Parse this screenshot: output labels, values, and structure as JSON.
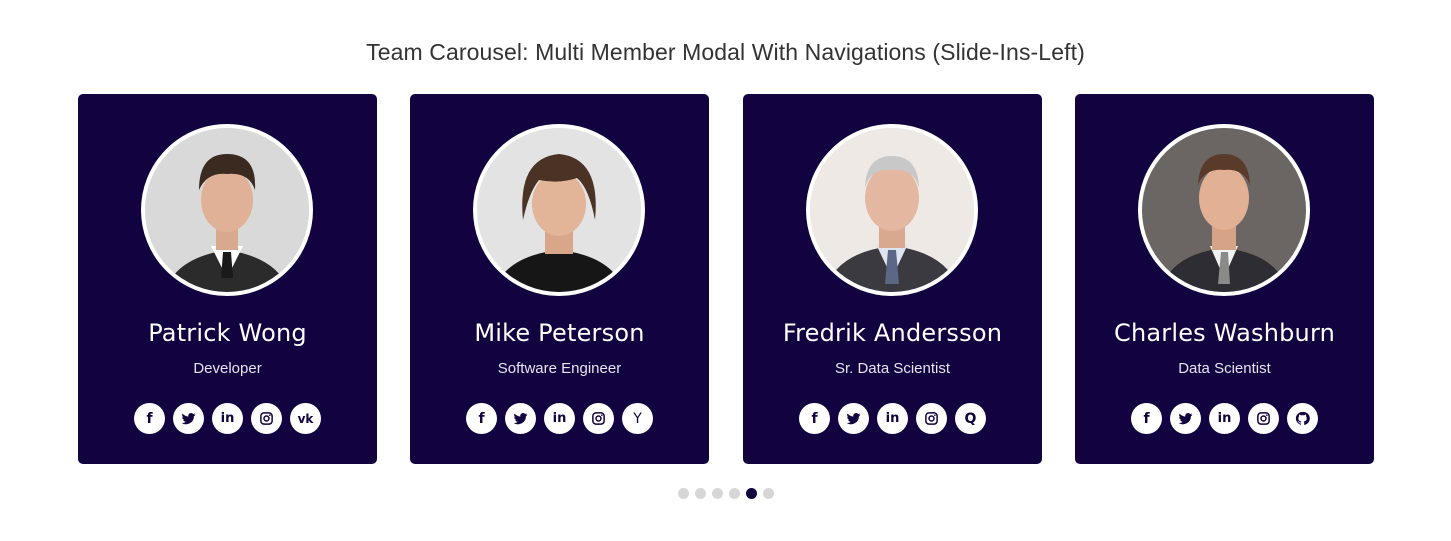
{
  "page": {
    "title": "Team Carousel: Multi Member Modal With Navigations (Slide-Ins-Left)"
  },
  "colors": {
    "card_background": "#12023f",
    "card_text": "#ffffff",
    "dot_inactive": "#d6d6d6",
    "dot_active": "#12023f"
  },
  "members": [
    {
      "name": "Patrick Wong",
      "role": "Developer",
      "photo_icon": "person-photo",
      "socials": [
        "facebook-icon",
        "twitter-icon",
        "linkedin-icon",
        "instagram-icon",
        "vk-icon"
      ]
    },
    {
      "name": "Mike Peterson",
      "role": "Software Engineer",
      "photo_icon": "person-photo",
      "socials": [
        "facebook-icon",
        "twitter-icon",
        "linkedin-icon",
        "instagram-icon",
        "ycombinator-icon"
      ]
    },
    {
      "name": "Fredrik Andersson",
      "role": "Sr. Data Scientist",
      "photo_icon": "person-photo",
      "socials": [
        "facebook-icon",
        "twitter-icon",
        "linkedin-icon",
        "instagram-icon",
        "quora-icon"
      ]
    },
    {
      "name": "Charles Washburn",
      "role": "Data Scientist",
      "photo_icon": "person-photo",
      "socials": [
        "facebook-icon",
        "twitter-icon",
        "linkedin-icon",
        "instagram-icon",
        "github-icon"
      ]
    }
  ],
  "pagination": {
    "total": 6,
    "active_index": 4
  }
}
